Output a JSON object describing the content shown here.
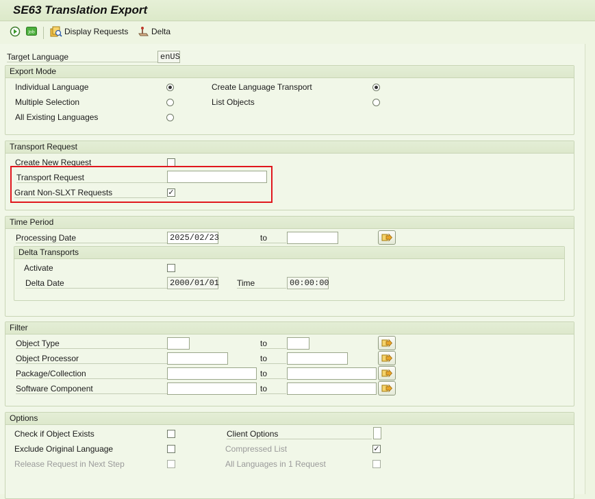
{
  "window": {
    "title": "SE63 Translation Export"
  },
  "toolbar": {
    "display_requests": "Display Requests",
    "delta": "Delta"
  },
  "target_language": {
    "label": "Target Language",
    "value": "enUS"
  },
  "export_mode": {
    "title": "Export Mode",
    "individual_language": "Individual Language",
    "multiple_selection": "Multiple Selection",
    "all_existing_languages": "All Existing Languages",
    "create_language_transport": "Create Language Transport",
    "list_objects": "List Objects"
  },
  "transport_request": {
    "title": "Transport Request",
    "create_new_request": "Create New Request",
    "transport_request_label": "Transport Request",
    "transport_request_value": "",
    "grant_non_slxt": "Grant Non-SLXT Requests"
  },
  "time_period": {
    "title": "Time Period",
    "processing_date_label": "Processing Date",
    "processing_date_value": "2025/02/23",
    "to": "to",
    "processing_date_to": "",
    "delta_transports": {
      "title": "Delta Transports",
      "activate": "Activate",
      "delta_date_label": "Delta Date",
      "delta_date_value": "2000/01/01",
      "time_label": "Time",
      "time_value": "00:00:00"
    }
  },
  "filter": {
    "title": "Filter",
    "to": "to",
    "object_type": "Object Type",
    "object_processor": "Object Processor",
    "package_collection": "Package/Collection",
    "software_component": "Software Component"
  },
  "options": {
    "title": "Options",
    "check_if_object_exists": "Check if Object Exists",
    "exclude_original_language": "Exclude Original Language",
    "release_request_next_step": "Release Request in Next Step",
    "client_options": "Client Options",
    "compressed_list": "Compressed List",
    "all_languages_1_request": "All Languages in 1 Request"
  },
  "state": {
    "export_mode_selected": "individual_language",
    "transport_option_selected": "create_language_transport",
    "grant_non_slxt_checked": true,
    "compressed_list_checked": true
  },
  "colors": {
    "highlight": "#e0161d",
    "background": "#eef5e2",
    "group_header": "#dde8cc"
  }
}
